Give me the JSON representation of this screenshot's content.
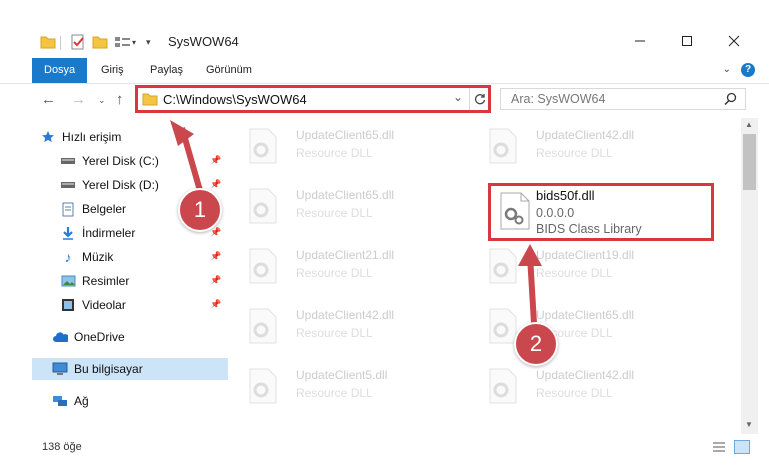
{
  "window": {
    "title": "SysWOW64"
  },
  "ribbon": {
    "tabs": [
      "Dosya",
      "Giriş",
      "Paylaş",
      "Görünüm"
    ],
    "help": "?"
  },
  "address": {
    "path": "C:\\Windows\\SysWOW64",
    "search_placeholder": "Ara: SysWOW64"
  },
  "nav": {
    "items": [
      {
        "label": "Hızlı erişim",
        "icon": "star-icon"
      },
      {
        "label": "Yerel Disk (C:)",
        "icon": "drive-icon",
        "pinned": true
      },
      {
        "label": "Yerel Disk (D:)",
        "icon": "drive-icon",
        "pinned": true
      },
      {
        "label": "Belgeler",
        "icon": "document-icon",
        "pinned": true
      },
      {
        "label": "İndirmeler",
        "icon": "download-icon",
        "pinned": true
      },
      {
        "label": "Müzik",
        "icon": "music-icon",
        "pinned": true
      },
      {
        "label": "Resimler",
        "icon": "pictures-icon",
        "pinned": true
      },
      {
        "label": "Videolar",
        "icon": "video-icon",
        "pinned": true
      },
      {
        "label": "OneDrive",
        "icon": "cloud-icon"
      },
      {
        "label": "Bu bilgisayar",
        "icon": "computer-icon"
      },
      {
        "label": "Ağ",
        "icon": "network-icon"
      }
    ]
  },
  "files": [
    {
      "name": "UpdateClient65.dll",
      "type": "Resource DLL"
    },
    {
      "name": "UpdateClient42.dll",
      "type": "Resource DLL"
    },
    {
      "name": "UpdateClient65.dll",
      "type": "Resource DLL"
    },
    {
      "name": "UpdateClient21.dll",
      "type": "Resource DLL"
    },
    {
      "name": "UpdateClient19.dll",
      "type": "Resource DLL"
    },
    {
      "name": "UpdateClient42.dll",
      "type": "Resource DLL"
    },
    {
      "name": "UpdateClient65.dll",
      "type": "Resource DLL"
    },
    {
      "name": "UpdateClient5.dll",
      "type": "Resource DLL"
    },
    {
      "name": "UpdateClient42.dll",
      "type": "Resource DLL"
    }
  ],
  "highlighted_file": {
    "name": "bids50f.dll",
    "version": "0.0.0.0",
    "type": "BIDS Class Library"
  },
  "annotations": {
    "badge1": "1",
    "badge2": "2",
    "color": "#d9363e"
  },
  "status": {
    "count": "138 öğe"
  }
}
